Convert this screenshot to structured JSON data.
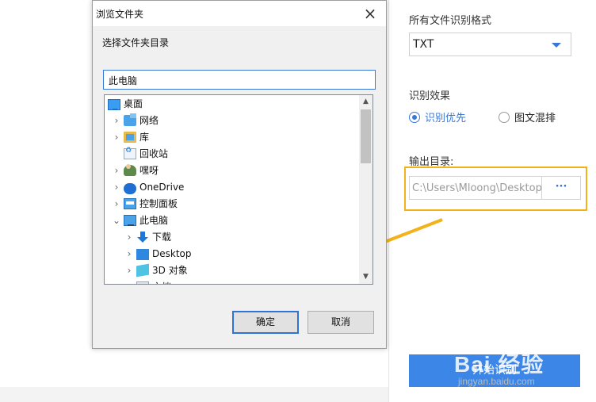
{
  "dialog": {
    "title": "浏览文件夹",
    "close_label": "×",
    "prompt": "选择文件夹目录",
    "folder_value": "此电脑",
    "tree": [
      {
        "label": "桌面",
        "icon": "desktop-monitor-icon",
        "level": 0,
        "expander": ""
      },
      {
        "label": "网络",
        "icon": "network-icon",
        "level": 1,
        "expander": "›"
      },
      {
        "label": "库",
        "icon": "library-icon",
        "level": 1,
        "expander": "›"
      },
      {
        "label": "回收站",
        "icon": "recycle-bin-icon",
        "level": 1,
        "expander": ""
      },
      {
        "label": "嘿呀",
        "icon": "user-icon",
        "level": 1,
        "expander": "›"
      },
      {
        "label": "OneDrive",
        "icon": "onedrive-cloud-icon",
        "level": 1,
        "expander": "›"
      },
      {
        "label": "控制面板",
        "icon": "control-panel-icon",
        "level": 1,
        "expander": "›"
      },
      {
        "label": "此电脑",
        "icon": "this-pc-icon",
        "level": 1,
        "expander": "⌄"
      },
      {
        "label": "下载",
        "icon": "download-arrow-icon",
        "level": 2,
        "expander": "›"
      },
      {
        "label": "Desktop",
        "icon": "desktop-folder-icon",
        "level": 2,
        "expander": "›"
      },
      {
        "label": "3D 对象",
        "icon": "3d-objects-icon",
        "level": 2,
        "expander": "›"
      },
      {
        "label": "文档",
        "icon": "documents-icon",
        "level": 2,
        "expander": "›"
      }
    ],
    "ok_label": "确定",
    "cancel_label": "取消"
  },
  "panel": {
    "format_label": "所有文件识别格式",
    "format_value": "TXT",
    "effect_label": "识别效果",
    "radio_options": [
      {
        "label": "识别优先",
        "selected": true
      },
      {
        "label": "图文混排",
        "selected": false
      }
    ],
    "output_label": "输出目录:",
    "output_path": "C:\\Users\\Mloong\\Desktop",
    "browse_label": "···",
    "start_label": "开始识别"
  },
  "watermark": {
    "brand": "Bai 经验",
    "url": "jingyan.baidu.com"
  },
  "colors": {
    "accent": "#3a78d8",
    "highlight": "#f3b21a",
    "start_button": "#3c86e8"
  }
}
